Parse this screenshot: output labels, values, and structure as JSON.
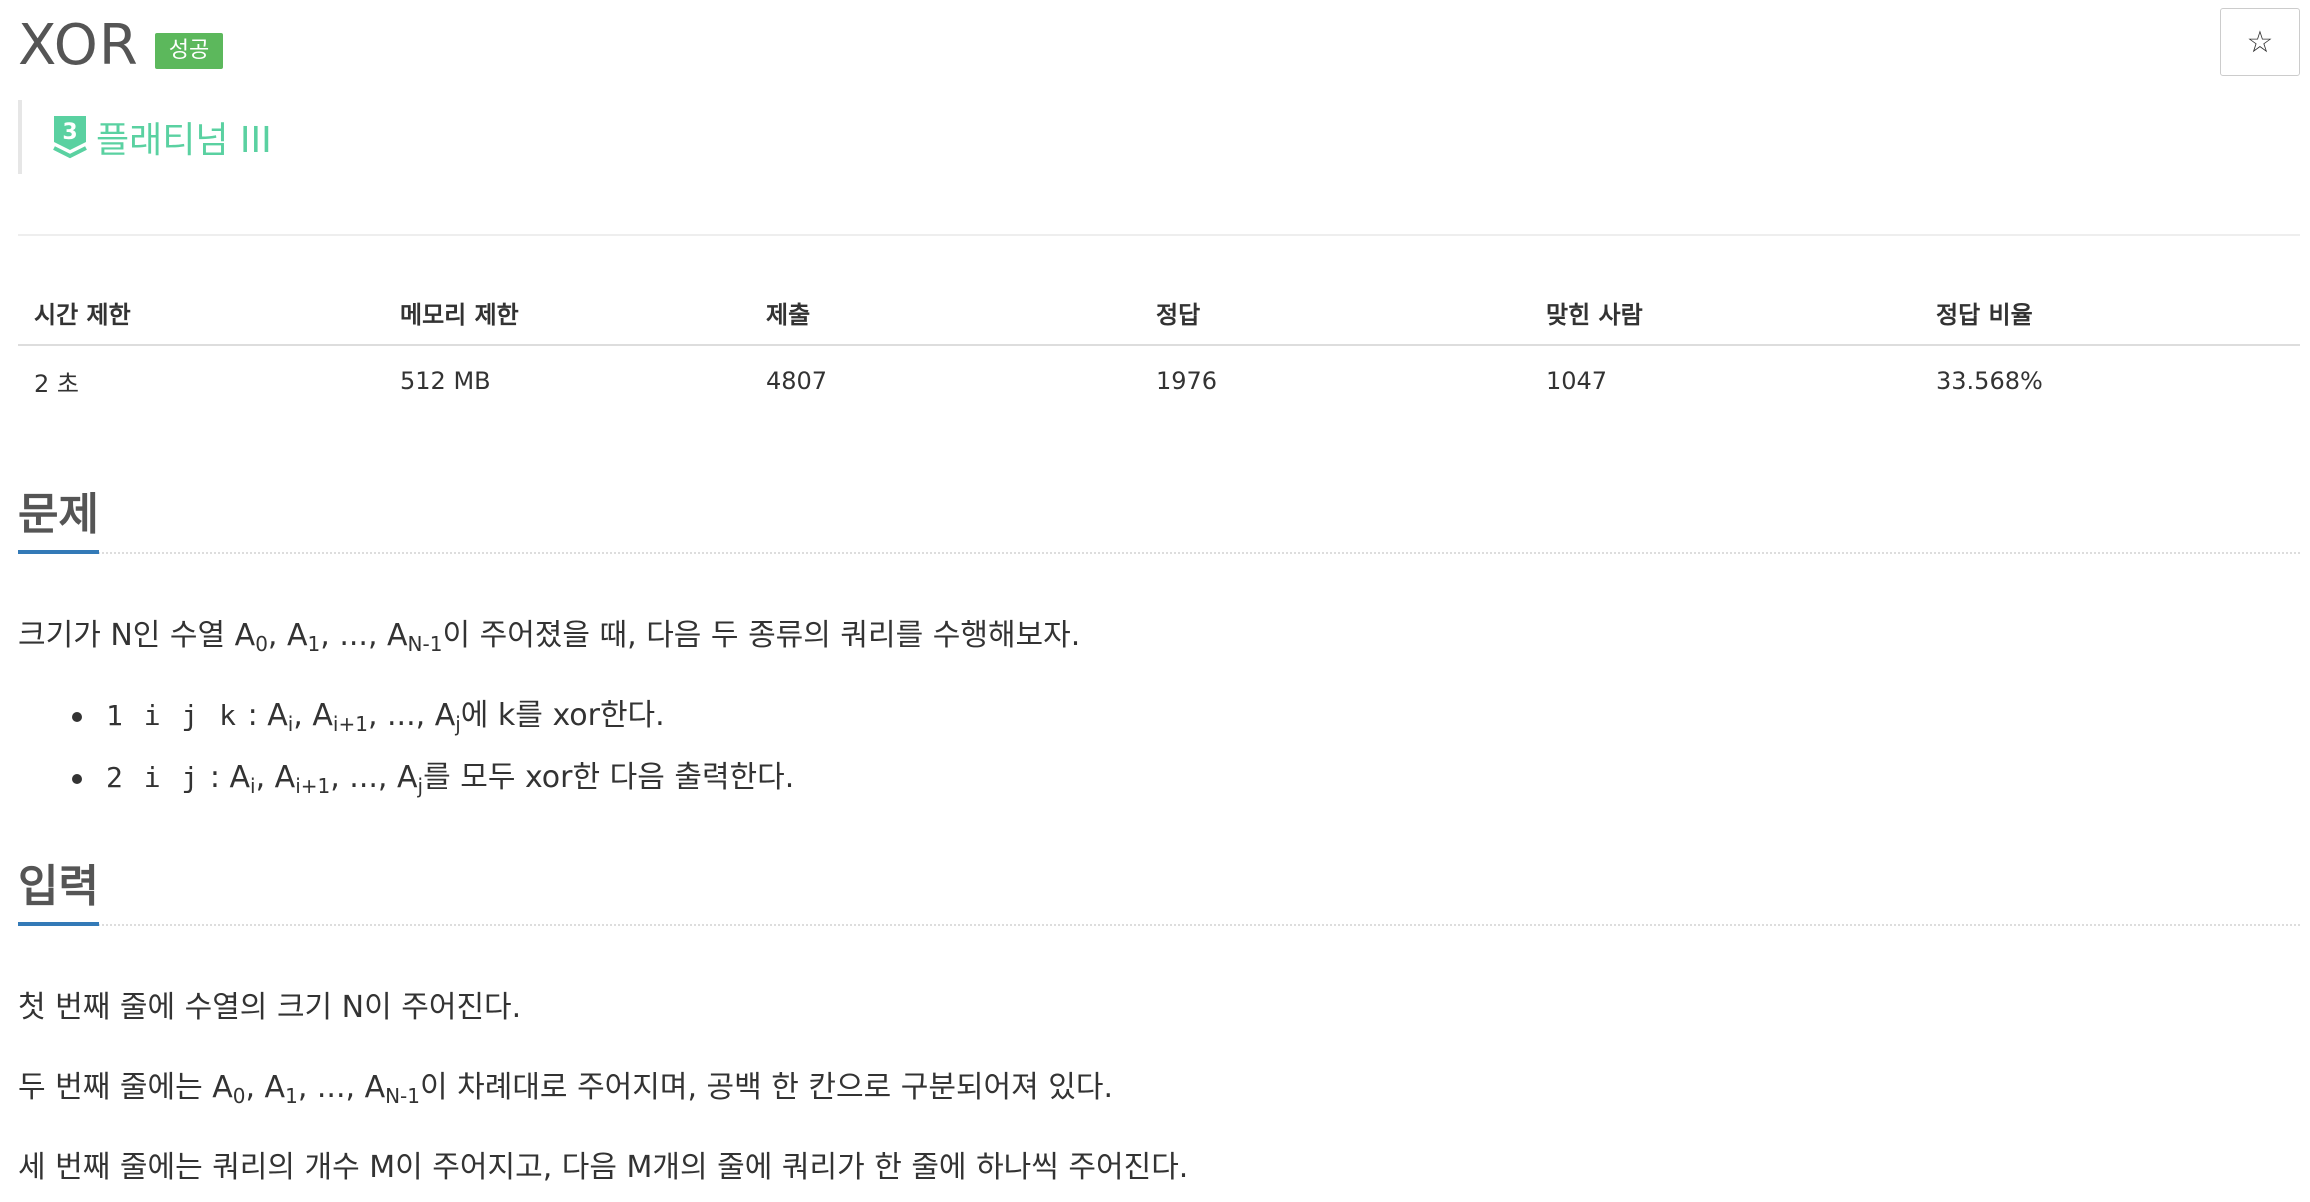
{
  "header": {
    "title": "XOR",
    "status_badge": "성공",
    "star_icon": "☆"
  },
  "tier": {
    "level_number": "3",
    "label": "플래티넘 III",
    "color": "#5ad1a1"
  },
  "stats": {
    "headers": [
      "시간 제한",
      "메모리 제한",
      "제출",
      "정답",
      "맞힌 사람",
      "정답 비율"
    ],
    "values": [
      "2 초",
      "512 MB",
      "4807",
      "1976",
      "1047",
      "33.568%"
    ]
  },
  "problem": {
    "title": "문제",
    "intro": {
      "p1": "크기가 N인 수열 A",
      "sub0": "0",
      "p2": ", A",
      "sub1": "1",
      "p3": ", ..., A",
      "subN": "N-1",
      "p4": "이 주어졌을 때, 다음 두 종류의 쿼리를 수행해보자."
    },
    "queries": [
      {
        "code": "1 i j k",
        "t1": ": A",
        "s1": "i",
        "t2": ", A",
        "s2": "i+1",
        "t3": ", ..., A",
        "s3": "j",
        "t4": "에 k를 xor한다."
      },
      {
        "code": "2 i j",
        "t1": ": A",
        "s1": "i",
        "t2": ", A",
        "s2": "i+1",
        "t3": ", ..., A",
        "s3": "j",
        "t4": "를 모두 xor한 다음 출력한다."
      }
    ]
  },
  "input": {
    "title": "입력",
    "line1": "첫 번째 줄에 수열의 크기 N이 주어진다.",
    "line2": {
      "p1": "두 번째 줄에는 A",
      "sub0": "0",
      "p2": ", A",
      "sub1": "1",
      "p3": ", ..., A",
      "subN": "N-1",
      "p4": "이 차례대로 주어지며, 공백 한 칸으로 구분되어져 있다."
    },
    "line3": "세 번째 줄에는 쿼리의 개수 M이 주어지고, 다음 M개의 줄에 쿼리가 한 줄에 하나씩 주어진다."
  }
}
